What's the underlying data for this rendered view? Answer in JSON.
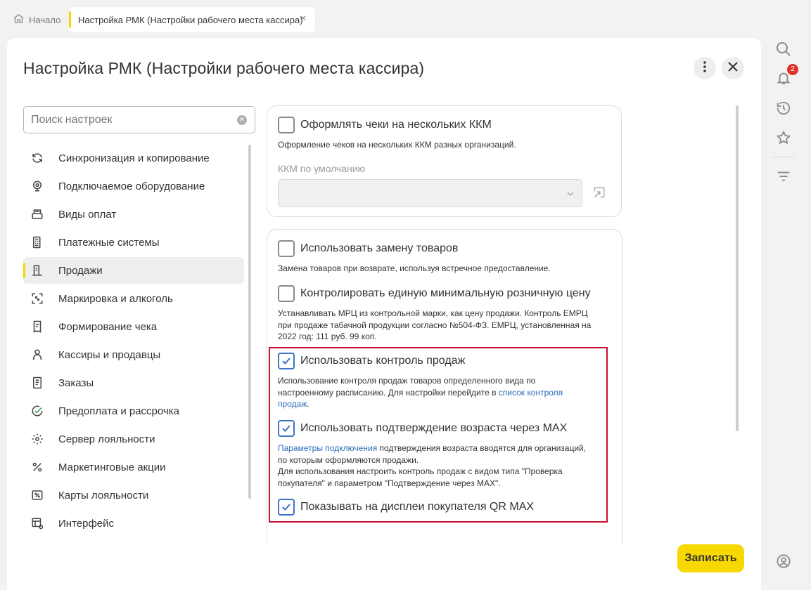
{
  "tabs": {
    "home_label": "Начало",
    "active_label": "Настройка РМК (Настройки рабочего места кассира)"
  },
  "page": {
    "title": "Настройка РМК (Настройки рабочего места кассира)",
    "save_label": "Записать"
  },
  "search": {
    "placeholder": "Поиск настроек"
  },
  "sidebar": {
    "items": [
      {
        "label": "Синхронизация и копирование",
        "icon": "sync-icon"
      },
      {
        "label": "Подключаемое оборудование",
        "icon": "webcam-icon"
      },
      {
        "label": "Виды оплат",
        "icon": "payment-terminal-icon"
      },
      {
        "label": "Платежные системы",
        "icon": "pos-terminal-icon"
      },
      {
        "label": "Продажи",
        "icon": "receipt-icon",
        "active": true
      },
      {
        "label": "Маркировка и алкоголь",
        "icon": "scan-icon"
      },
      {
        "label": "Формирование чека",
        "icon": "receipt-build-icon"
      },
      {
        "label": "Кассиры и продавцы",
        "icon": "person-icon"
      },
      {
        "label": "Заказы",
        "icon": "document-icon"
      },
      {
        "label": "Предоплата и рассрочка",
        "icon": "prepay-icon"
      },
      {
        "label": "Сервер лояльности",
        "icon": "gear-icon"
      },
      {
        "label": "Маркетинговые акции",
        "icon": "percent-icon"
      },
      {
        "label": "Карты лояльности",
        "icon": "card-percent-icon"
      },
      {
        "label": "Интерфейс",
        "icon": "interface-icon"
      }
    ]
  },
  "settings": {
    "multi_kkm": {
      "label": "Оформлять чеки на нескольких ККМ",
      "hint": "Оформление чеков на нескольких ККМ разных организаций.",
      "checked": false,
      "field_label": "ККМ по умолчанию",
      "field_value": ""
    },
    "replace_goods": {
      "label": "Использовать замену товаров",
      "hint": "Замена товаров при возврате, используя встречное предоставление.",
      "checked": false
    },
    "min_price": {
      "label": "Контролировать единую минимальную розничную цену",
      "hint_line1": "Устанавливать МРЦ из контрольной марки, как цену продажи. Контроль ЕМРЦ",
      "hint_line2": "при продаже табачной продукции согласно №504-ФЗ. ЕМРЦ, установленная на",
      "hint_line3": "2022 год: 111 руб. 99 коп.",
      "checked": false
    },
    "sales_control": {
      "label": "Использовать контроль продаж",
      "hint_line1": "Использование контроля продаж товаров определенного вида по",
      "hint_line2_pre": "настроенному расписанию. Для настройки перейдите в ",
      "hint_link_part1": "список контроля",
      "hint_link_part2": "продаж",
      "hint_end": ".",
      "checked": true
    },
    "age_confirm": {
      "label": "Использовать подтверждение возраста через MAX",
      "hint_link": "Параметры подключения",
      "hint_line1_post": " подтверждения возраста вводятся для организаций,",
      "hint_line2": "по которым оформляются продажи.",
      "hint_line3": "Для использования настроить контроль продаж с видом типа \"Проверка",
      "hint_line4": "покупателя\" и параметром \"Подтверждение через MAX\".",
      "checked": true
    },
    "qr_display": {
      "label": "Показывать на дисплеи покупателя QR MAX",
      "checked": true
    }
  },
  "rail": {
    "notifications_count": "2"
  },
  "colors": {
    "accent_yellow": "#f7d800",
    "checkbox_blue": "#3b74c4",
    "link_blue": "#2b6cb8",
    "highlight_red": "#c8102e",
    "badge_red": "#e0312a"
  }
}
